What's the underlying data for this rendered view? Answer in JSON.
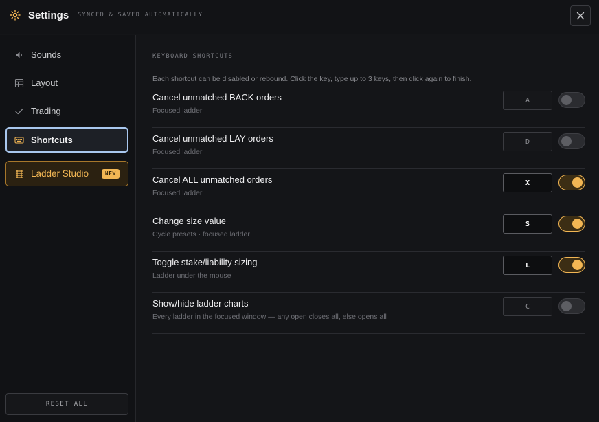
{
  "header": {
    "title": "Settings",
    "subtitle": "SYNCED & SAVED AUTOMATICALLY",
    "icon": "gear-icon",
    "close_icon": "close-icon"
  },
  "sidebar": {
    "items": [
      {
        "label": "Sounds",
        "icon": "speaker-icon",
        "state": "default"
      },
      {
        "label": "Layout",
        "icon": "grid-icon",
        "state": "default"
      },
      {
        "label": "Trading",
        "icon": "check-icon",
        "state": "default"
      },
      {
        "label": "Shortcuts",
        "icon": "keyboard-icon",
        "state": "active"
      },
      {
        "label": "Ladder Studio",
        "icon": "ladder-icon",
        "state": "highlight",
        "badge": "NEW"
      }
    ],
    "reset_label": "RESET ALL"
  },
  "main": {
    "section_title": "KEYBOARD SHORTCUTS",
    "helper": "Each shortcut can be disabled or rebound. Click the key, type up to 3 keys, then click again to finish.",
    "shortcuts": [
      {
        "title": "Cancel unmatched BACK orders",
        "subtitle": "Focused ladder",
        "key": "A",
        "enabled": false
      },
      {
        "title": "Cancel unmatched LAY orders",
        "subtitle": "Focused ladder",
        "key": "D",
        "enabled": false
      },
      {
        "title": "Cancel ALL unmatched orders",
        "subtitle": "Focused ladder",
        "key": "X",
        "enabled": true
      },
      {
        "title": "Change size value",
        "subtitle": "Cycle presets · focused ladder",
        "key": "S",
        "enabled": true
      },
      {
        "title": "Toggle stake/liability sizing",
        "subtitle": "Ladder under the mouse",
        "key": "L",
        "enabled": true
      },
      {
        "title": "Show/hide ladder charts",
        "subtitle": "Every ladder in the focused window — any open closes all, else opens all",
        "key": "C",
        "enabled": false
      }
    ]
  },
  "colors": {
    "accent": "#f2b654",
    "active_border": "#a9c7ee",
    "background": "#141518"
  }
}
